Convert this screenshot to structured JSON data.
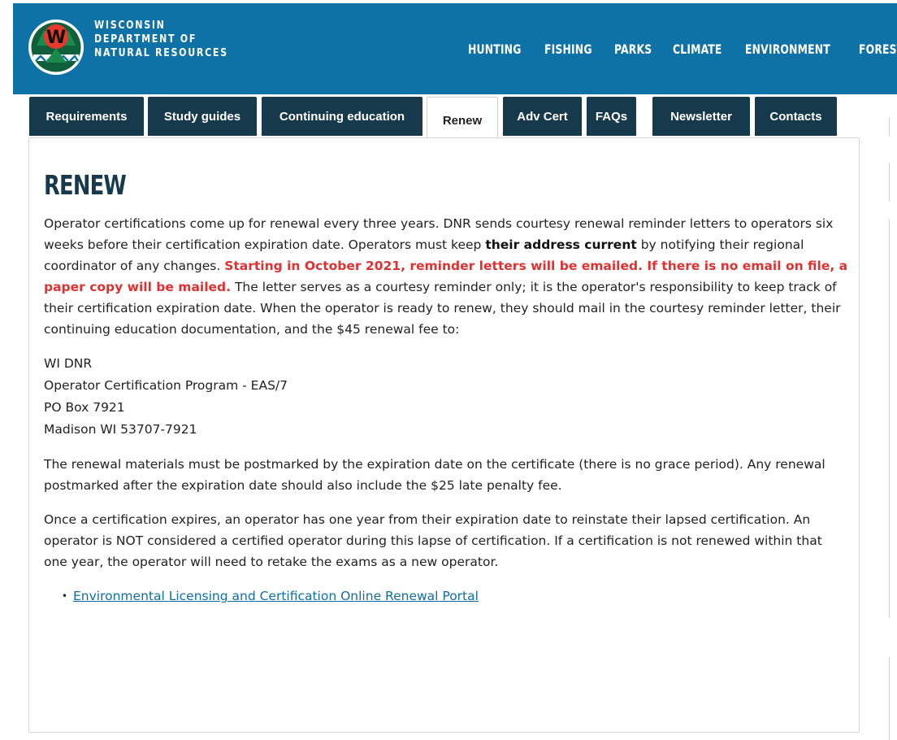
{
  "header": {
    "agency_line1": "WISCONSIN",
    "agency_line2": "DEPARTMENT OF",
    "agency_line3": "NATURAL RESOURCES",
    "logo_letter": "W",
    "bg_color": "#0f72a6",
    "nav": [
      "HUNTING",
      "FISHING",
      "PARKS",
      "CLIMATE",
      "ENVIRONMENT",
      "FORESTRY"
    ]
  },
  "tabs": [
    {
      "label": "Requirements",
      "active": false
    },
    {
      "label": "Study guides",
      "active": false
    },
    {
      "label": "Continuing education",
      "active": false
    },
    {
      "label": "Renew",
      "active": true
    },
    {
      "label": "Adv Cert",
      "active": false
    },
    {
      "label": "FAQs",
      "active": false
    },
    {
      "label": "Newsletter",
      "active": false
    },
    {
      "label": "Contacts",
      "active": false
    }
  ],
  "main": {
    "heading": "RENEW",
    "p1": {
      "a": "Operator certifications come up for renewal every three years. DNR sends courtesy renewal reminder letters to operators six weeks before their certification expiration date. Operators must keep ",
      "b": "their address current",
      "c": " by notifying their regional coordinator of any changes. ",
      "d": "Starting in October 2021, reminder letters will be emailed. If there is no email on file, a paper copy will be mailed.",
      "e": " The letter serves as a courtesy reminder only; it is the operator's responsibility to keep track of their certification expiration date. When the operator is ready to renew, they should mail in the courtesy reminder letter, their continuing education documentation, and the $45 renewal fee to:"
    },
    "address": [
      "WI DNR",
      "Operator Certification Program - EAS/7",
      "PO Box 7921",
      "Madison WI 53707-7921"
    ],
    "p2": "The renewal materials must be postmarked by the expiration date on the certificate (there is no grace period). Any renewal postmarked after the expiration date should also include the $25 late penalty fee.",
    "p3": "Once a certification expires, an operator has one year from their expiration date to reinstate their lapsed certification. An operator is NOT considered a certified operator during this lapse of certification. If a certification is not renewed within that one year, the operator will need to retake the exams as a new operator.",
    "link": "Environmental Licensing and Certification Online Renewal Portal"
  },
  "colors": {
    "tab_bg": "#16394c",
    "heading": "#17394d",
    "alert": "#e03131",
    "link": "#0f6ea5"
  }
}
